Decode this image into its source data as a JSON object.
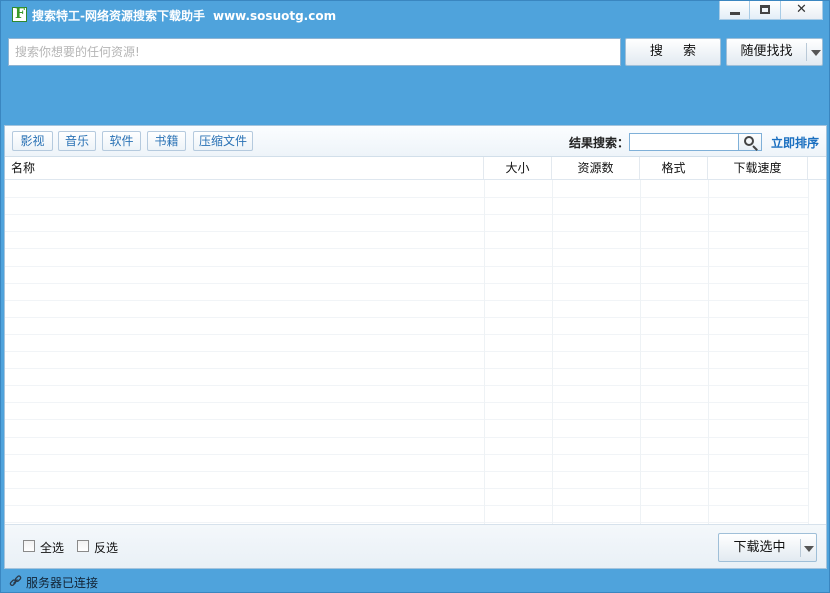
{
  "window": {
    "logo_letter": "F",
    "title": "搜索特工-网络资源搜索下载助手",
    "url": "www.sosuotg.com",
    "controls": {
      "minimize": "minimize-icon",
      "maximize": "maximize-icon",
      "close_glyph": "✕"
    }
  },
  "search": {
    "placeholder": "搜索你想要的任何资源!",
    "value": "",
    "search_label": "搜 索",
    "random_label": "随便找找"
  },
  "categories": [
    "影视",
    "音乐",
    "软件",
    "书籍",
    "压缩文件"
  ],
  "filter": {
    "label": "结果搜索：",
    "value": "",
    "sort_label": "立即排序"
  },
  "table": {
    "columns": [
      "名称",
      "大小",
      "资源数",
      "格式",
      "下载速度"
    ],
    "rows": []
  },
  "footer": {
    "select_all_label": "全选",
    "invert_label": "反选",
    "download_label": "下载选中"
  },
  "status": {
    "icon": "link-icon",
    "text": "服务器已连接"
  },
  "colors": {
    "frame": "#4fa3dc",
    "link": "#1a6fc0",
    "category_text": "#2a72b5"
  }
}
